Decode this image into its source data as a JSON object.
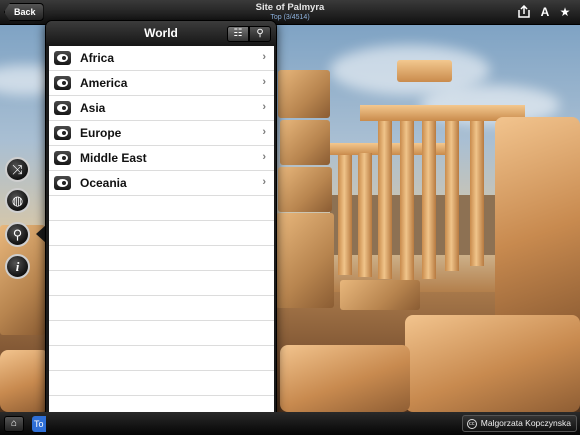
{
  "topbar": {
    "back_label": "Back",
    "title": "Site of Palmyra",
    "subtitle": "Top (3/4514)",
    "share_icon": "share-icon",
    "font_icon_glyph": "A",
    "star_glyph": "★"
  },
  "tools": [
    {
      "icon": "shuffle-icon",
      "glyph": "⤨"
    },
    {
      "icon": "globe-icon",
      "glyph": "◍"
    },
    {
      "icon": "search-icon",
      "glyph": "⚲"
    },
    {
      "icon": "info-icon",
      "glyph": "i"
    }
  ],
  "popover": {
    "title": "World",
    "list_view_glyph": "☷",
    "search_glyph": "⚲",
    "items": [
      {
        "label": "Africa"
      },
      {
        "label": "America"
      },
      {
        "label": "Asia"
      },
      {
        "label": "Europe"
      },
      {
        "label": "Middle East"
      },
      {
        "label": "Oceania"
      }
    ],
    "chevron": "›"
  },
  "bottombar": {
    "home_glyph": "⌂",
    "tab_label": "To",
    "cc_label": "cc",
    "credit": "Malgorzata Kopczynska"
  }
}
